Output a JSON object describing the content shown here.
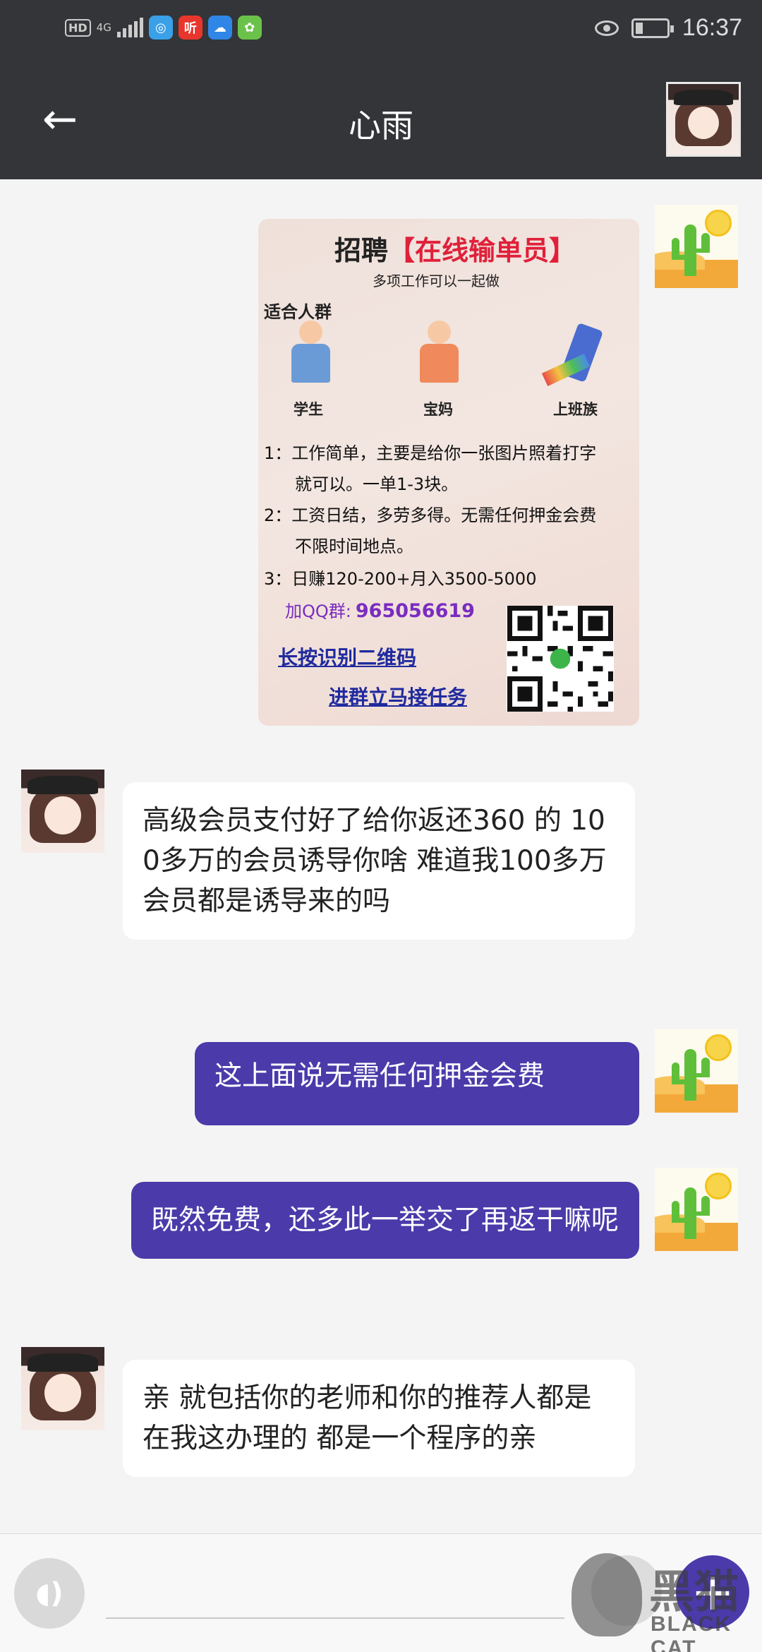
{
  "status_bar": {
    "hd_label": "HD",
    "network_label": "4G",
    "app_icons": [
      {
        "name": "browser-app-icon",
        "glyph": "◎",
        "color": "#3aa0e8"
      },
      {
        "name": "listen-app-icon",
        "glyph": "听",
        "color": "#e8362c"
      },
      {
        "name": "cloud-app-icon",
        "glyph": "☁",
        "color": "#2f86e6"
      },
      {
        "name": "game-app-icon",
        "glyph": "✿",
        "color": "#6bc24a"
      }
    ],
    "time": "16:37"
  },
  "header": {
    "back_glyph": "←",
    "title": "心雨"
  },
  "poster": {
    "title_prefix": "招聘",
    "title_highlight": "【在线输单员】",
    "subtitle": "多项工作可以一起做",
    "people_label": "适合人群",
    "groups": [
      "学生",
      "宝妈",
      "上班族"
    ],
    "lines": [
      "1：工作简单，主要是给你一张图片照着打字",
      "就可以。一单1-3块。",
      "2：工资日结，多劳多得。无需任何押金会费",
      "不限时间地点。",
      "3：日赚120-200+月入3500-5000"
    ],
    "qq_label": "加QQ群:",
    "qq_number": "965056619",
    "link_1": "长按识别二维码",
    "link_2": "进群立马接任务"
  },
  "messages": [
    {
      "side": "in",
      "text": "高级会员支付好了给你返还360 的  100多万的会员诱导你啥  难道我100多万会员都是诱导来的吗"
    },
    {
      "side": "out",
      "text": "这上面说无需任何押金会费"
    },
    {
      "side": "out",
      "text": "既然免费，还多此一举交了再返干嘛呢"
    },
    {
      "side": "in",
      "text": "亲  就包括你的老师和你的推荐人都是在我这办理的  都是一个程序的亲"
    }
  ],
  "input_bar": {
    "voice_glyph": "◖)",
    "input_value": "",
    "plus_glyph": "+"
  },
  "watermark": {
    "text_cn": "黑猫",
    "text_en": "BLACK CAT"
  },
  "colors": {
    "header_bg": "#333538",
    "outgoing_bubble": "#4a3aaa",
    "incoming_bubble": "#ffffff",
    "chat_bg": "#f4f4f4"
  }
}
